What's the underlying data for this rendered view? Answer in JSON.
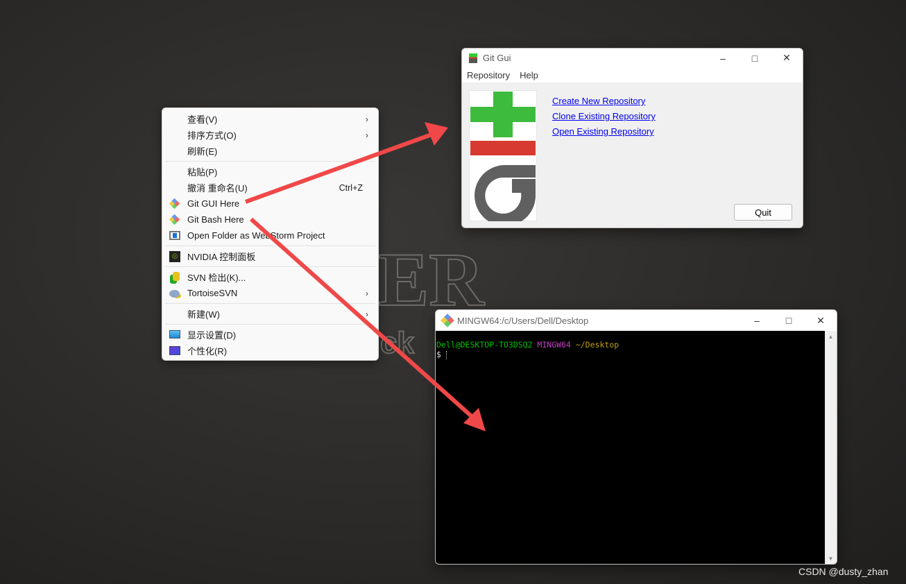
{
  "wallpaper": {
    "text_large": "ER",
    "text_small": "ck"
  },
  "context_menu": {
    "items": [
      {
        "label": "查看(V)",
        "submenu": true
      },
      {
        "label": "排序方式(O)",
        "submenu": true
      },
      {
        "label": "刷新(E)"
      },
      {
        "separator": true
      },
      {
        "label": "粘贴(P)"
      },
      {
        "label": "撤消 重命名(U)",
        "shortcut": "Ctrl+Z"
      },
      {
        "label": "Git GUI Here",
        "icon": "git-icon"
      },
      {
        "label": "Git Bash Here",
        "icon": "git-icon"
      },
      {
        "label": "Open Folder as WebStorm Project",
        "icon": "webstorm-icon"
      },
      {
        "separator": true
      },
      {
        "label": "NVIDIA 控制面板",
        "icon": "nvidia-icon"
      },
      {
        "separator": true
      },
      {
        "label": "SVN 检出(K)...",
        "icon": "svn-checkout-icon"
      },
      {
        "label": "TortoiseSVN",
        "icon": "tortoisesvn-icon",
        "submenu": true
      },
      {
        "separator": true
      },
      {
        "label": "新建(W)",
        "submenu": true
      },
      {
        "separator": true
      },
      {
        "label": "显示设置(D)",
        "icon": "display-icon"
      },
      {
        "label": "个性化(R)",
        "icon": "personalize-icon"
      }
    ]
  },
  "git_gui": {
    "title": "Git Gui",
    "menus": [
      "Repository",
      "Help"
    ],
    "links": [
      "Create New Repository",
      "Clone Existing Repository",
      "Open Existing Repository"
    ],
    "quit_label": "Quit"
  },
  "terminal": {
    "title": "MINGW64:/c/Users/Dell/Desktop",
    "prompt_user": "Dell@DESKTOP-TO3DSQ2",
    "prompt_system": "MINGW64",
    "prompt_path": "~/Desktop",
    "prompt_symbol": "$",
    "colors": {
      "user": "#00c000",
      "system": "#c040c0",
      "path": "#c0a000"
    }
  },
  "annotation_color": "#f04848",
  "watermark": "CSDN @dusty_zhan"
}
